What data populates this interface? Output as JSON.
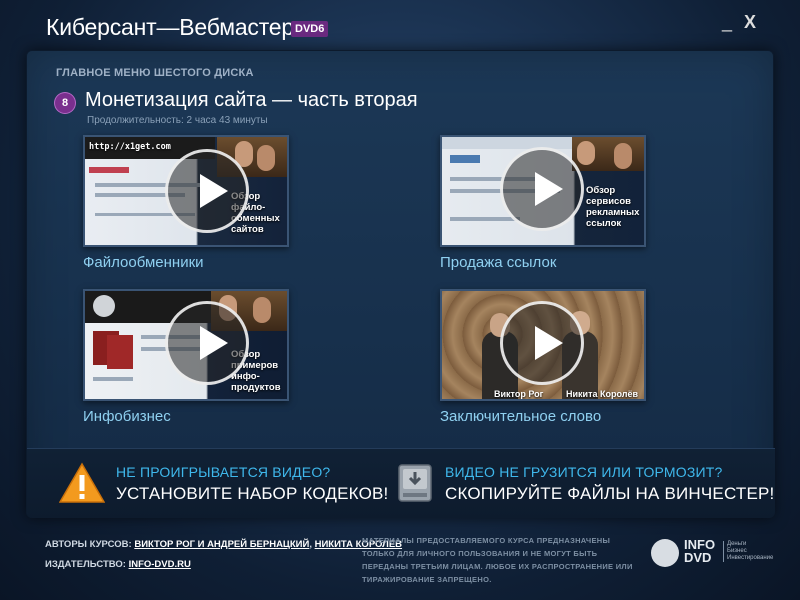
{
  "window": {
    "title": "Киберсант—Вебмастер",
    "badge": "DVD6",
    "minimize": "_",
    "close": "X"
  },
  "menu": {
    "heading": "ГЛАВНОЕ МЕНЮ ШЕСТОГО ДИСКА",
    "module_number": "8",
    "module_title": "Монетизация сайта — часть вторая",
    "duration": "Продолжительность: 2 часа 43 минуты"
  },
  "videos": [
    {
      "label": "Файлообменники",
      "caption": [
        "Обзор",
        "файло-",
        "обменных",
        "сайтов"
      ],
      "url_text": "http://x1get.com"
    },
    {
      "label": "Продажа ссылок",
      "caption": [
        "Обзор",
        "сервисов",
        "рекламных",
        "ссылок"
      ]
    },
    {
      "label": "Инфобизнес",
      "caption": [
        "Обзор",
        "примеров",
        "инфо-",
        "продуктов"
      ]
    },
    {
      "label": "Заключительное слово",
      "names": [
        "Виктор Рог",
        "Никита Королёв"
      ]
    }
  ],
  "help": {
    "codec_question": "НЕ ПРОИГРЫВАЕТСЯ ВИДЕО?",
    "codec_action": "УСТАНОВИТЕ НАБОР КОДЕКОВ!",
    "hdd_question": "ВИДЕО НЕ ГРУЗИТСЯ ИЛИ ТОРМОЗИТ?",
    "hdd_action": "СКОПИРУЙТЕ ФАЙЛЫ НА ВИНЧЕСТЕР!"
  },
  "footer": {
    "authors_label": "АВТОРЫ КУРСОВ:",
    "authors_link1": "ВИКТОР РОГ И АНДРЕЙ БЕРНАЦКИЙ",
    "authors_sep": ",",
    "authors_link2": "НИКИТА КОРОЛЕВ",
    "publisher_label": "ИЗДАТЕЛЬСТВО:",
    "publisher_link": "INFO-DVD.RU",
    "disclaimer": "МАТЕРИАЛЫ ПРЕДОСТАВЛЯЕМОГО КУРСА ПРЕДНАЗНАЧЕНЫ ТОЛЬКО ДЛЯ ЛИЧНОГО ПОЛЬЗОВАНИЯ И НЕ МОГУТ БЫТЬ ПЕРЕДАНЫ ТРЕТЬИМ ЛИЦАМ. ЛЮБОЕ ИХ РАСПРОСТРАНЕНИЕ ИЛИ ТИРАЖИРОВАНИЕ ЗАПРЕЩЕНО.",
    "logo_line1": "INFO",
    "logo_line2": "DVD",
    "logo_sub": [
      "Деньги",
      "Бизнес",
      "Инвестирование"
    ]
  },
  "colors": {
    "accent_blue": "#3fb8ec",
    "label_blue": "#8fd0f0",
    "badge_purple": "#7a2f8e",
    "warning_orange": "#f39a1e"
  },
  "icons": {
    "warning": "warning-icon",
    "hdd": "hard-drive-icon",
    "play": "play-icon"
  }
}
